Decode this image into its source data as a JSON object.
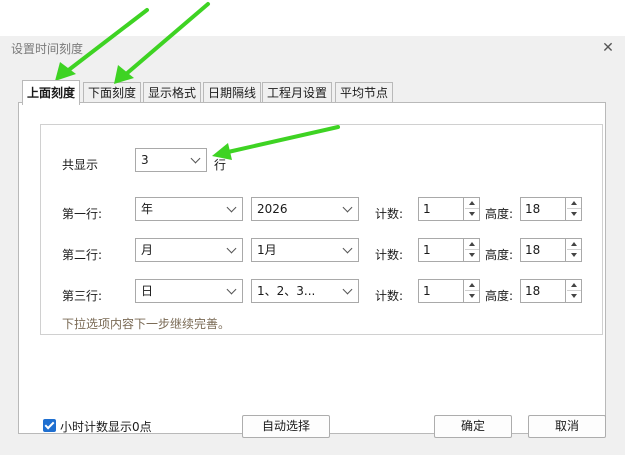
{
  "dialog": {
    "title": "设置时间刻度",
    "close_glyph": "✕"
  },
  "tabs": [
    {
      "label": "上面刻度",
      "active": true
    },
    {
      "label": "下面刻度",
      "active": false
    },
    {
      "label": "显示格式",
      "active": false
    },
    {
      "label": "日期隔线",
      "active": false
    },
    {
      "label": "工程月设置",
      "active": false
    },
    {
      "label": "平均节点",
      "active": false
    }
  ],
  "total": {
    "label": "共显示",
    "value": "3",
    "unit": "行"
  },
  "rows": [
    {
      "label": "第一行:",
      "unit": "年",
      "format": "2026",
      "count_label": "计数:",
      "count": "1",
      "height_label": "高度:",
      "height": "18"
    },
    {
      "label": "第二行:",
      "unit": "月",
      "format": "1月",
      "count_label": "计数:",
      "count": "1",
      "height_label": "高度:",
      "height": "18"
    },
    {
      "label": "第三行:",
      "unit": "日",
      "format": "1、2、3...",
      "count_label": "计数:",
      "count": "1",
      "height_label": "高度:",
      "height": "18"
    }
  ],
  "hint": "下拉选项内容下一步继续完善。",
  "footer": {
    "checkbox_label": "小时计数显示0点",
    "checkbox_checked": true,
    "auto_select": "自动选择",
    "ok": "确定",
    "cancel": "取消"
  },
  "colors": {
    "accent": "#1f6fd0",
    "annotation_arrow": "#3ed323"
  }
}
